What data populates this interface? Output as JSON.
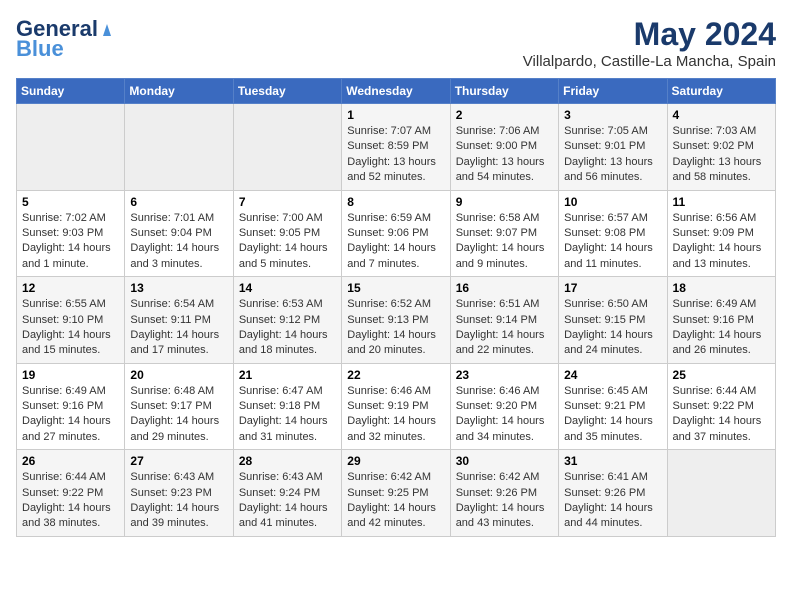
{
  "header": {
    "logo_line1": "General",
    "logo_line2": "Blue",
    "title": "May 2024",
    "subtitle": "Villalpardo, Castille-La Mancha, Spain"
  },
  "days_of_week": [
    "Sunday",
    "Monday",
    "Tuesday",
    "Wednesday",
    "Thursday",
    "Friday",
    "Saturday"
  ],
  "weeks": [
    [
      {
        "day": "",
        "info": ""
      },
      {
        "day": "",
        "info": ""
      },
      {
        "day": "",
        "info": ""
      },
      {
        "day": "1",
        "info": "Sunrise: 7:07 AM\nSunset: 8:59 PM\nDaylight: 13 hours\nand 52 minutes."
      },
      {
        "day": "2",
        "info": "Sunrise: 7:06 AM\nSunset: 9:00 PM\nDaylight: 13 hours\nand 54 minutes."
      },
      {
        "day": "3",
        "info": "Sunrise: 7:05 AM\nSunset: 9:01 PM\nDaylight: 13 hours\nand 56 minutes."
      },
      {
        "day": "4",
        "info": "Sunrise: 7:03 AM\nSunset: 9:02 PM\nDaylight: 13 hours\nand 58 minutes."
      }
    ],
    [
      {
        "day": "5",
        "info": "Sunrise: 7:02 AM\nSunset: 9:03 PM\nDaylight: 14 hours\nand 1 minute."
      },
      {
        "day": "6",
        "info": "Sunrise: 7:01 AM\nSunset: 9:04 PM\nDaylight: 14 hours\nand 3 minutes."
      },
      {
        "day": "7",
        "info": "Sunrise: 7:00 AM\nSunset: 9:05 PM\nDaylight: 14 hours\nand 5 minutes."
      },
      {
        "day": "8",
        "info": "Sunrise: 6:59 AM\nSunset: 9:06 PM\nDaylight: 14 hours\nand 7 minutes."
      },
      {
        "day": "9",
        "info": "Sunrise: 6:58 AM\nSunset: 9:07 PM\nDaylight: 14 hours\nand 9 minutes."
      },
      {
        "day": "10",
        "info": "Sunrise: 6:57 AM\nSunset: 9:08 PM\nDaylight: 14 hours\nand 11 minutes."
      },
      {
        "day": "11",
        "info": "Sunrise: 6:56 AM\nSunset: 9:09 PM\nDaylight: 14 hours\nand 13 minutes."
      }
    ],
    [
      {
        "day": "12",
        "info": "Sunrise: 6:55 AM\nSunset: 9:10 PM\nDaylight: 14 hours\nand 15 minutes."
      },
      {
        "day": "13",
        "info": "Sunrise: 6:54 AM\nSunset: 9:11 PM\nDaylight: 14 hours\nand 17 minutes."
      },
      {
        "day": "14",
        "info": "Sunrise: 6:53 AM\nSunset: 9:12 PM\nDaylight: 14 hours\nand 18 minutes."
      },
      {
        "day": "15",
        "info": "Sunrise: 6:52 AM\nSunset: 9:13 PM\nDaylight: 14 hours\nand 20 minutes."
      },
      {
        "day": "16",
        "info": "Sunrise: 6:51 AM\nSunset: 9:14 PM\nDaylight: 14 hours\nand 22 minutes."
      },
      {
        "day": "17",
        "info": "Sunrise: 6:50 AM\nSunset: 9:15 PM\nDaylight: 14 hours\nand 24 minutes."
      },
      {
        "day": "18",
        "info": "Sunrise: 6:49 AM\nSunset: 9:16 PM\nDaylight: 14 hours\nand 26 minutes."
      }
    ],
    [
      {
        "day": "19",
        "info": "Sunrise: 6:49 AM\nSunset: 9:16 PM\nDaylight: 14 hours\nand 27 minutes."
      },
      {
        "day": "20",
        "info": "Sunrise: 6:48 AM\nSunset: 9:17 PM\nDaylight: 14 hours\nand 29 minutes."
      },
      {
        "day": "21",
        "info": "Sunrise: 6:47 AM\nSunset: 9:18 PM\nDaylight: 14 hours\nand 31 minutes."
      },
      {
        "day": "22",
        "info": "Sunrise: 6:46 AM\nSunset: 9:19 PM\nDaylight: 14 hours\nand 32 minutes."
      },
      {
        "day": "23",
        "info": "Sunrise: 6:46 AM\nSunset: 9:20 PM\nDaylight: 14 hours\nand 34 minutes."
      },
      {
        "day": "24",
        "info": "Sunrise: 6:45 AM\nSunset: 9:21 PM\nDaylight: 14 hours\nand 35 minutes."
      },
      {
        "day": "25",
        "info": "Sunrise: 6:44 AM\nSunset: 9:22 PM\nDaylight: 14 hours\nand 37 minutes."
      }
    ],
    [
      {
        "day": "26",
        "info": "Sunrise: 6:44 AM\nSunset: 9:22 PM\nDaylight: 14 hours\nand 38 minutes."
      },
      {
        "day": "27",
        "info": "Sunrise: 6:43 AM\nSunset: 9:23 PM\nDaylight: 14 hours\nand 39 minutes."
      },
      {
        "day": "28",
        "info": "Sunrise: 6:43 AM\nSunset: 9:24 PM\nDaylight: 14 hours\nand 41 minutes."
      },
      {
        "day": "29",
        "info": "Sunrise: 6:42 AM\nSunset: 9:25 PM\nDaylight: 14 hours\nand 42 minutes."
      },
      {
        "day": "30",
        "info": "Sunrise: 6:42 AM\nSunset: 9:26 PM\nDaylight: 14 hours\nand 43 minutes."
      },
      {
        "day": "31",
        "info": "Sunrise: 6:41 AM\nSunset: 9:26 PM\nDaylight: 14 hours\nand 44 minutes."
      },
      {
        "day": "",
        "info": ""
      }
    ]
  ]
}
